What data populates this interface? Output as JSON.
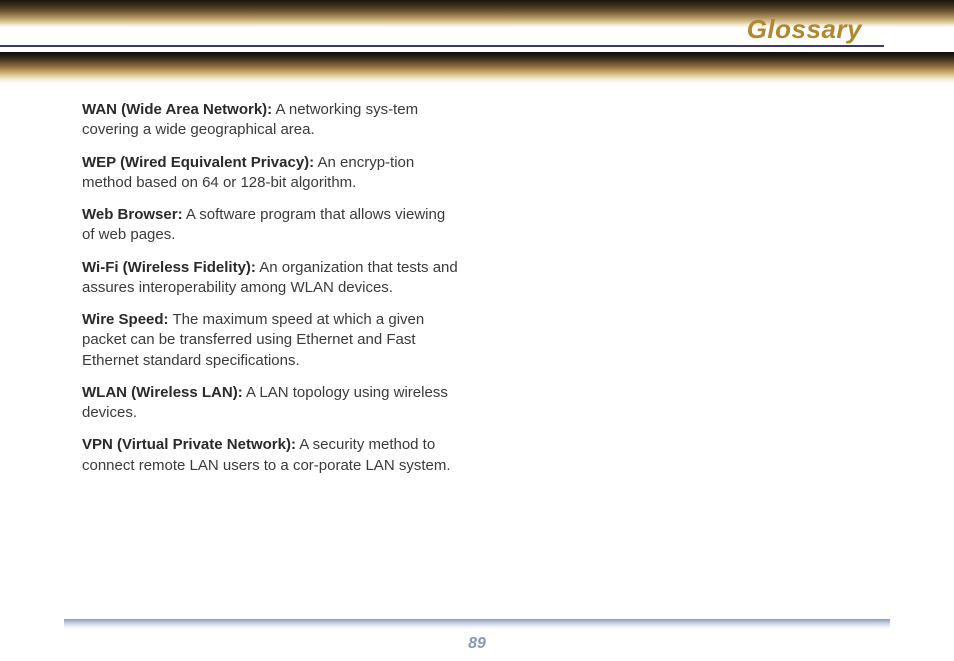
{
  "header": {
    "title": "Glossary"
  },
  "entries": [
    {
      "term": "WAN (Wide Area Network):",
      "def": "  A networking sys-tem covering a wide geographical area."
    },
    {
      "term": "WEP (Wired Equivalent Privacy):",
      "def": "  An encryp-tion method based on 64 or 128-bit algorithm."
    },
    {
      "term": "Web Browser:",
      "def": "  A software program that allows viewing of web pages."
    },
    {
      "term": "Wi-Fi (Wireless Fidelity):",
      "def": "  An organization that tests and assures interoperability among WLAN devices."
    },
    {
      "term": "Wire Speed:",
      "def": "  The maximum speed at which a given packet can be transferred using Ethernet and Fast Ethernet standard specifications."
    },
    {
      "term": "WLAN (Wireless LAN):",
      "def": "  A LAN topology using wireless devices."
    },
    {
      "term": "VPN (Virtual Private Network):",
      "def": "  A security method to connect remote LAN users to a cor-porate LAN system."
    }
  ],
  "footer": {
    "page_number": "89"
  }
}
